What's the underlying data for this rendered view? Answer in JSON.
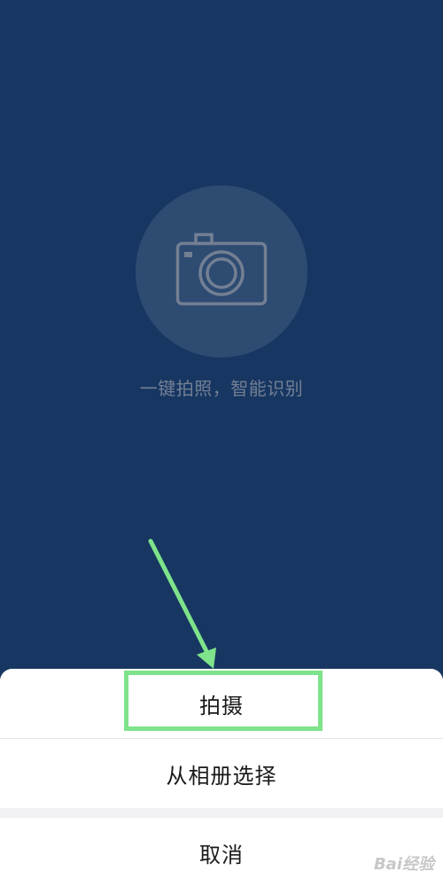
{
  "background_color": "#173762",
  "camera": {
    "icon": "camera-icon",
    "hint": "一键拍照，智能识别"
  },
  "action_sheet": {
    "shoot_label": "拍摄",
    "album_label": "从相册选择",
    "cancel_label": "取消"
  },
  "annotation": {
    "color": "#7ee38a",
    "target": "拍摄"
  },
  "watermark": {
    "text": "Bai经验"
  }
}
